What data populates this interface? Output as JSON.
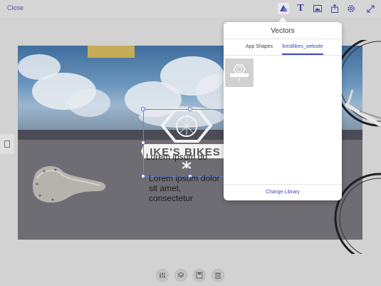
{
  "topbar": {
    "close_label": "Close",
    "tools": [
      "shapes-icon",
      "text-tool-icon",
      "image-icon",
      "share-icon",
      "settings-icon",
      "expand-icon"
    ]
  },
  "canvas": {
    "logo_text": "IKE'S BIKES",
    "partial_text": "Lorem ipsum do",
    "text_block": "Lorem ipsum dolor sit amet, consectetur"
  },
  "popover": {
    "title": "Vectors",
    "tabs": [
      {
        "label": "App Shapes",
        "active": false
      },
      {
        "label": "IkesBikes_website",
        "active": true
      }
    ],
    "footer": "Change Library"
  },
  "bottombar": {
    "buttons": [
      "adjust-icon",
      "layers-icon",
      "save-icon",
      "delete-icon"
    ]
  },
  "colors": {
    "accent": "#3d49b3",
    "selection": "#4a67c9",
    "ground": "#6f6d74",
    "sky": "#6b95bd",
    "yellow_block": "#c6ac59"
  }
}
